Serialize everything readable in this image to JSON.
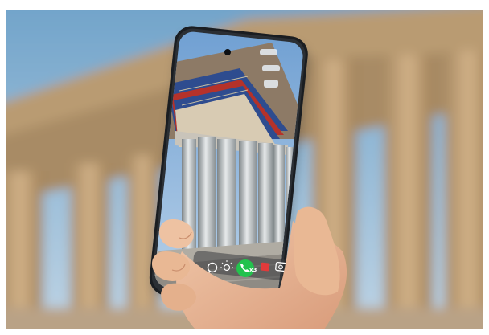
{
  "scene": {
    "description_icons": [
      "chat-icon",
      "lightbulb-icon",
      "call-icon",
      "record-icon",
      "camera-icon"
    ],
    "colors": {
      "sky_top": "#6fa2c9",
      "sky_bottom": "#b9d1e3",
      "stone": "#c7a77a",
      "stone_dark": "#9c7e58",
      "frieze_blue": "#2e4c8f",
      "frieze_red": "#b5322a",
      "call_green": "#23c24d",
      "record_red": "#e23a3a"
    }
  },
  "phone": {
    "toolbar": {
      "call_badge": "x3"
    }
  }
}
